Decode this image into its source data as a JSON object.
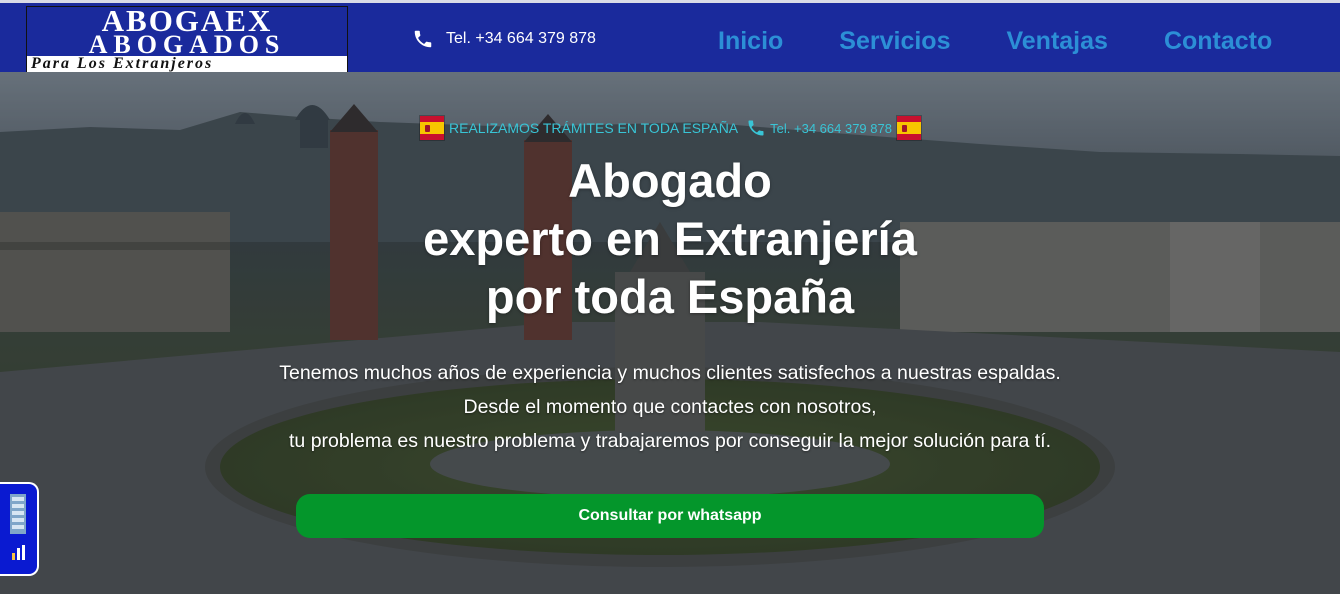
{
  "header": {
    "logo": {
      "line1": "ABOGAEX",
      "line2": "ABOGADOS",
      "tagline": "Para Los Extranjeros"
    },
    "phone": "Tel. +34 664 379 878",
    "nav": [
      "Inicio",
      "Servicios",
      "Ventajas",
      "Contacto"
    ]
  },
  "hero": {
    "topline": {
      "text": "REALIZAMOS TRÁMITES EN TODA ESPAÑA",
      "phone": "Tel. +34 664 379 878",
      "flag": "spain-flag"
    },
    "title_lines": [
      "Abogado",
      "experto en Extranjería",
      "por toda España"
    ],
    "subtitle_lines": [
      "Tenemos muchos años de experiencia y muchos clientes satisfechos a nuestras espaldas.",
      "Desde el momento que contactes con nosotros,",
      "tu problema es nuestro problema y trabajaremos por conseguir la mejor solución para tí."
    ],
    "cta": "Consultar por whatsapp"
  },
  "colors": {
    "header_bg": "#1a2a9c",
    "nav_link": "#2c8fd6",
    "topline_text": "#39c5d6",
    "cta_bg": "#04962b",
    "widget_bg": "#0a1ad1"
  },
  "icons": [
    "phone-icon",
    "spain-flag-icon",
    "accessibility-widget-icon",
    "stats-icon"
  ]
}
